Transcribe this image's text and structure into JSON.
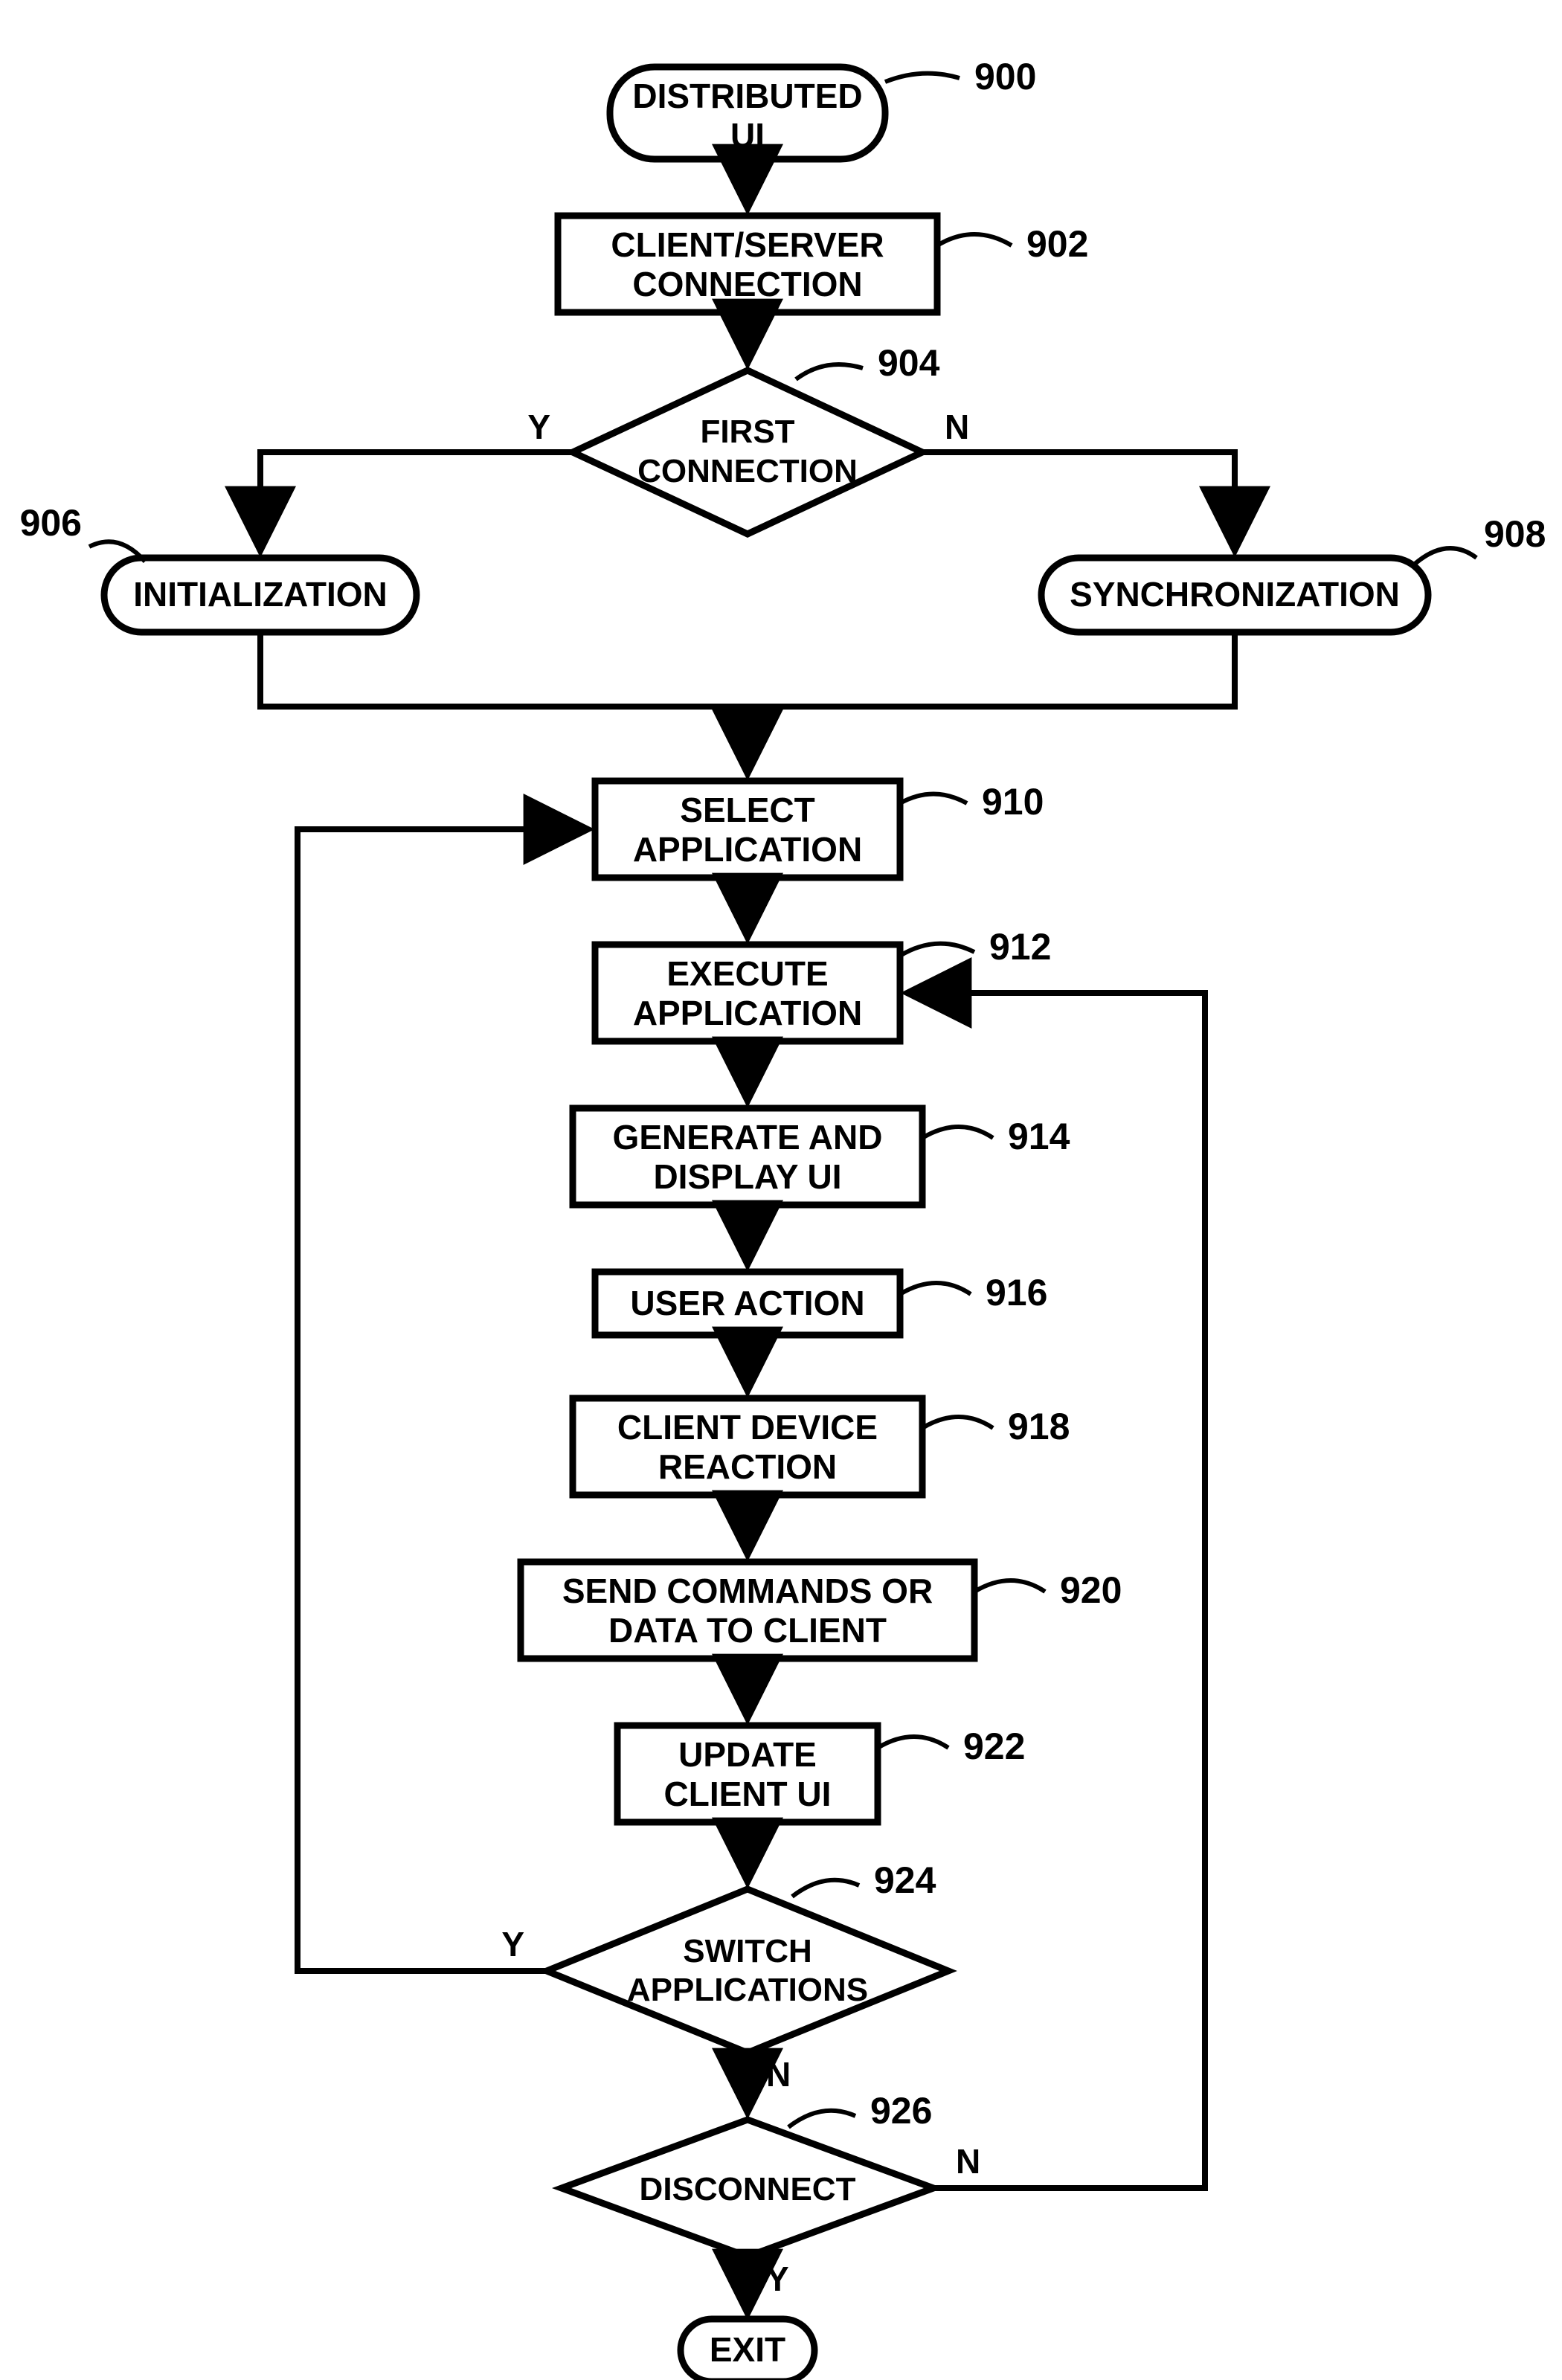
{
  "nodes": {
    "n900": {
      "text1": "DISTRIBUTED",
      "text2": "UI",
      "ref": "900"
    },
    "n902": {
      "text1": "CLIENT/SERVER",
      "text2": "CONNECTION",
      "ref": "902"
    },
    "n904": {
      "text1": "FIRST",
      "text2": "CONNECTION",
      "ref": "904",
      "yes": "Y",
      "no": "N"
    },
    "n906": {
      "text1": "INITIALIZATION",
      "ref": "906"
    },
    "n908": {
      "text1": "SYNCHRONIZATION",
      "ref": "908"
    },
    "n910": {
      "text1": "SELECT",
      "text2": "APPLICATION",
      "ref": "910"
    },
    "n912": {
      "text1": "EXECUTE",
      "text2": "APPLICATION",
      "ref": "912"
    },
    "n914": {
      "text1": "GENERATE AND",
      "text2": "DISPLAY UI",
      "ref": "914"
    },
    "n916": {
      "text1": "USER ACTION",
      "ref": "916"
    },
    "n918": {
      "text1": "CLIENT DEVICE",
      "text2": "REACTION",
      "ref": "918"
    },
    "n920": {
      "text1": "SEND COMMANDS OR",
      "text2": "DATA TO CLIENT",
      "ref": "920"
    },
    "n922": {
      "text1": "UPDATE",
      "text2": "CLIENT UI",
      "ref": "922"
    },
    "n924": {
      "text1": "SWITCH",
      "text2": "APPLICATIONS",
      "ref": "924",
      "yes": "Y",
      "no": "N"
    },
    "n926": {
      "text1": "DISCONNECT",
      "ref": "926",
      "yes": "Y",
      "no": "N"
    },
    "nexit": {
      "text1": "EXIT"
    }
  }
}
